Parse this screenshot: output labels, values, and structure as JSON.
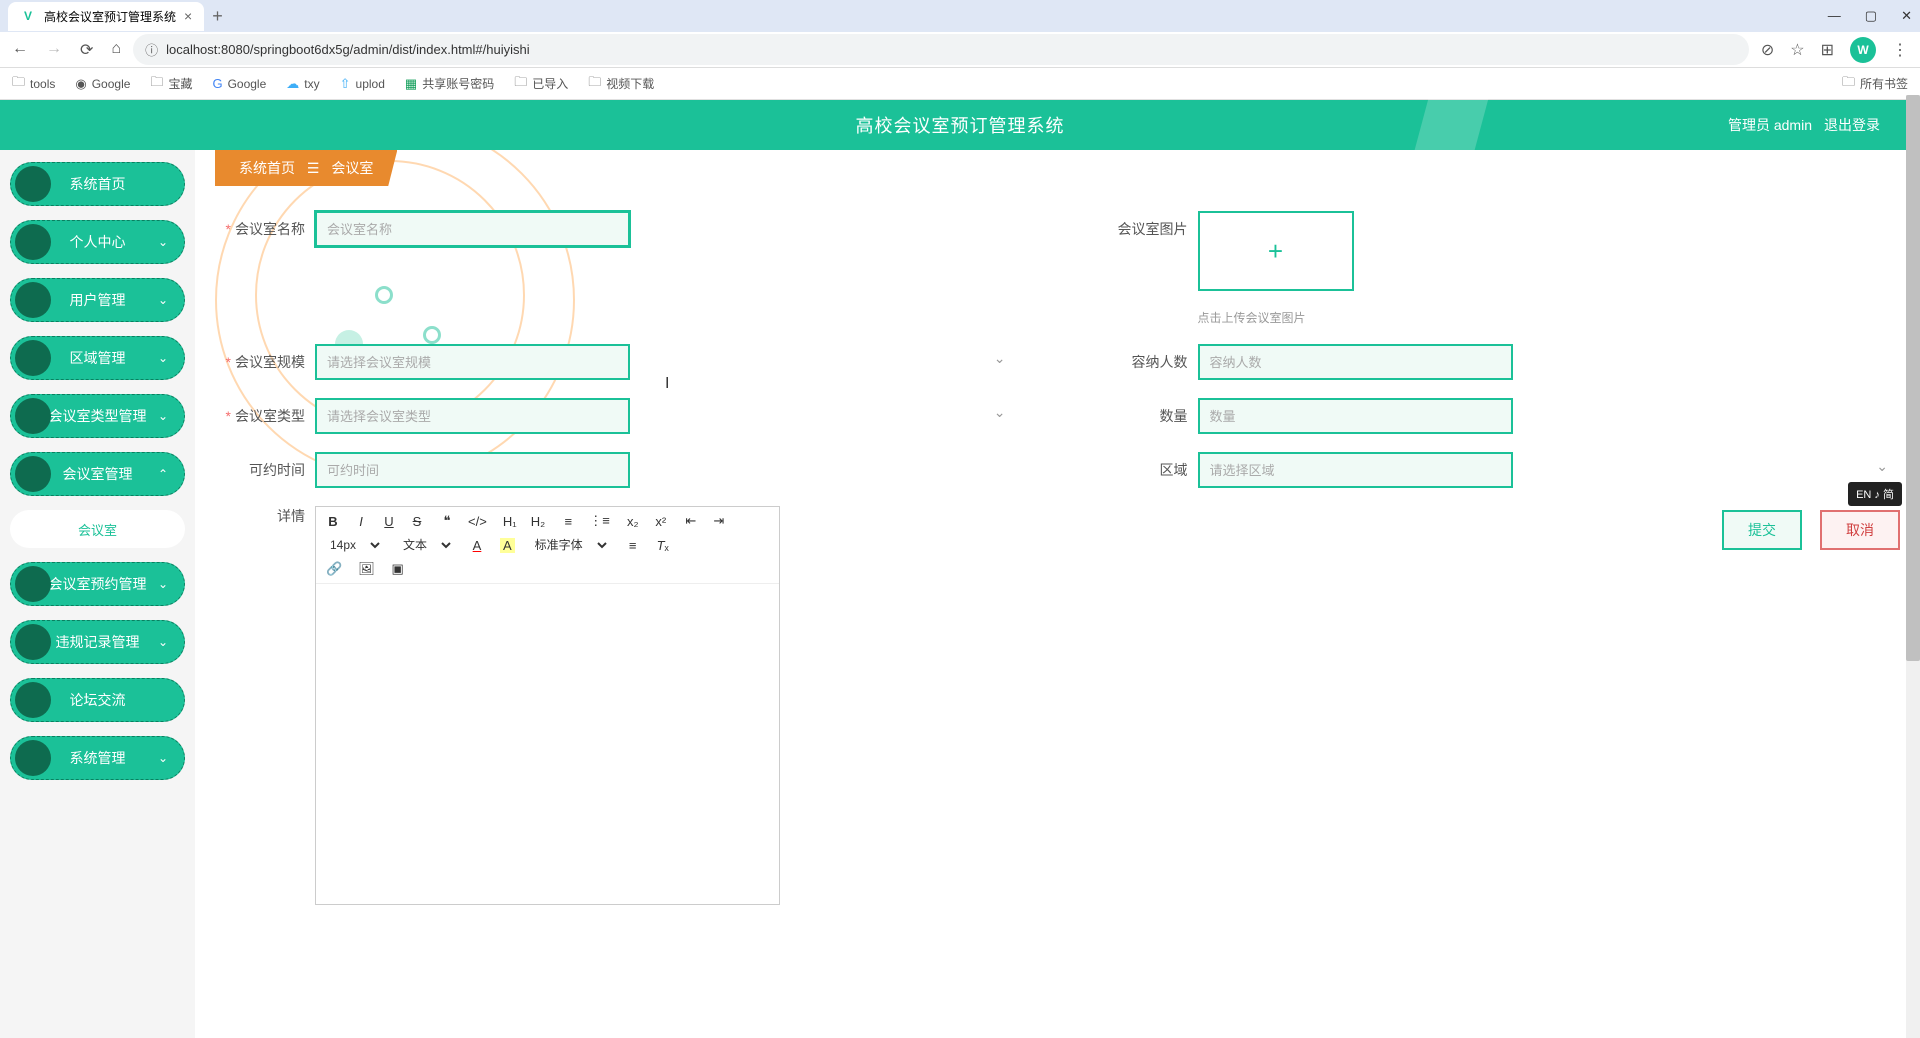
{
  "browser": {
    "tab_title": "高校会议室预订管理系统",
    "url": "localhost:8080/springboot6dx5g/admin/dist/index.html#/huiyishi",
    "avatar_letter": "W",
    "bookmarks": [
      "tools",
      "Google",
      "宝藏",
      "Google",
      "txy",
      "uplod",
      "共享账号密码",
      "已导入",
      "视频下载"
    ],
    "all_bookmarks": "所有书签"
  },
  "app": {
    "title": "高校会议室预订管理系统",
    "admin_label": "管理员 admin",
    "logout": "退出登录"
  },
  "sidebar": {
    "items": [
      {
        "label": "系统首页",
        "chevron": ""
      },
      {
        "label": "个人中心",
        "chevron": "⌄"
      },
      {
        "label": "用户管理",
        "chevron": "⌄"
      },
      {
        "label": "区域管理",
        "chevron": "⌄"
      },
      {
        "label": "会议室类型管理",
        "chevron": "⌄"
      },
      {
        "label": "会议室管理",
        "chevron": "⌃"
      },
      {
        "label": "会议室预约管理",
        "chevron": "⌄"
      },
      {
        "label": "违规记录管理",
        "chevron": "⌄"
      },
      {
        "label": "论坛交流",
        "chevron": ""
      },
      {
        "label": "系统管理",
        "chevron": "⌄"
      }
    ],
    "submenu": "会议室"
  },
  "breadcrumb": {
    "home": "系统首页",
    "sep": "☰",
    "current": "会议室"
  },
  "form": {
    "room_name": {
      "label": "会议室名称",
      "placeholder": "会议室名称",
      "required": true
    },
    "room_image": {
      "label": "会议室图片",
      "hint": "点击上传会议室图片"
    },
    "room_scale": {
      "label": "会议室规模",
      "placeholder": "请选择会议室规模",
      "required": true
    },
    "capacity": {
      "label": "容纳人数",
      "placeholder": "容纳人数"
    },
    "room_type": {
      "label": "会议室类型",
      "placeholder": "请选择会议室类型",
      "required": true
    },
    "quantity": {
      "label": "数量",
      "placeholder": "数量"
    },
    "available_time": {
      "label": "可约时间",
      "placeholder": "可约时间"
    },
    "region": {
      "label": "区域",
      "placeholder": "请选择区域"
    },
    "detail": {
      "label": "详情"
    }
  },
  "editor": {
    "font_size": "14px",
    "text_style": "文本",
    "font_family": "标准字体"
  },
  "actions": {
    "submit": "提交",
    "cancel": "取消"
  },
  "ime": "EN ♪ 简"
}
